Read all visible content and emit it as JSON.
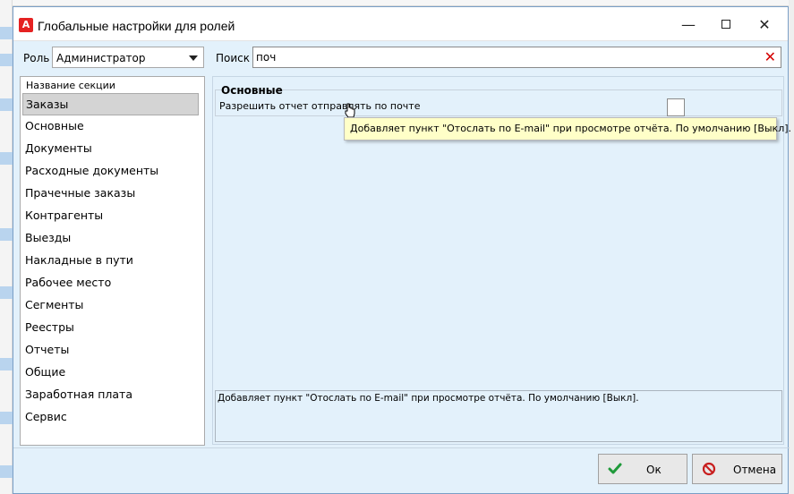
{
  "window": {
    "title": "Глобальные настройки для ролей",
    "minimize_label": "—",
    "close_label": "✕"
  },
  "filters": {
    "role_label": "Роль",
    "role_value": "Администратор",
    "search_label": "Поиск",
    "search_value": "поч"
  },
  "sections": {
    "header": "Название секции",
    "items": [
      {
        "label": "Заказы"
      },
      {
        "label": "Основные"
      },
      {
        "label": "Документы"
      },
      {
        "label": "Расходные документы"
      },
      {
        "label": "Прачечные заказы"
      },
      {
        "label": "Контрагенты"
      },
      {
        "label": "Выезды"
      },
      {
        "label": "Накладные в пути"
      },
      {
        "label": "Рабочее место"
      },
      {
        "label": "Сегменты"
      },
      {
        "label": "Реестры"
      },
      {
        "label": "Отчеты"
      },
      {
        "label": "Общие"
      },
      {
        "label": "Заработная плата"
      },
      {
        "label": "Сервис"
      }
    ],
    "selected": "Заказы"
  },
  "settings": {
    "group_title": "Основные",
    "items": [
      {
        "label": "Разрешить отчет отправлять по почте",
        "checked": false
      }
    ],
    "tooltip": "Добавляет пункт \"Отослать по E-mail\" при просмотре отчёта. По умолчанию [Выкл].",
    "description": "Добавляет пункт \"Отослать по E-mail\" при просмотре отчёта. По умолчанию [Выкл]."
  },
  "buttons": {
    "ok_label": "Ок",
    "cancel_label": "Отмена"
  },
  "colors": {
    "window_bg": "#e3f1fb",
    "clear_icon": "#d40000",
    "ok_check": "#1f9a3a",
    "cancel_icon": "#c81e1e",
    "tooltip_bg": "#ffffc8",
    "app_icon": "#e52222"
  },
  "icons": {
    "app": "app-logo-icon",
    "clear": "clear-icon",
    "ok": "checkmark-icon",
    "cancel": "no-entry-icon"
  }
}
